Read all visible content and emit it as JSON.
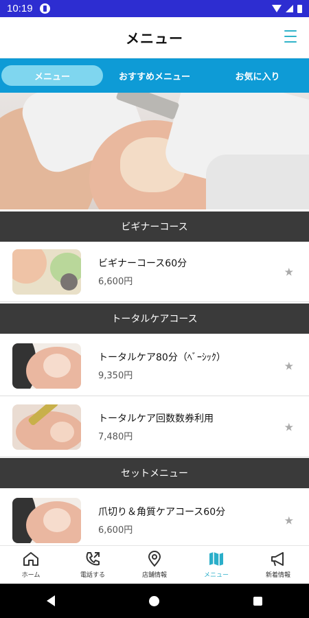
{
  "status_bar": {
    "time": "10:19"
  },
  "header": {
    "title": "メニュー"
  },
  "tabs": [
    {
      "label": "メニュー",
      "active": true
    },
    {
      "label": "おすすめメニュー",
      "active": false
    },
    {
      "label": "お気に入り",
      "active": false
    }
  ],
  "sections": [
    {
      "title": "ビギナーコース"
    },
    {
      "title": "トータルケアコース"
    },
    {
      "title": "セットメニュー"
    }
  ],
  "items": [
    {
      "name": "ビギナーコース60分",
      "price": "6,600円"
    },
    {
      "name": "トータルケア80分（ﾍﾞｰｼｯｸ）",
      "price": "9,350円"
    },
    {
      "name": "トータルケア回数数券利用",
      "price": "7,480円"
    },
    {
      "name": "爪切り＆角質ケアコース60分",
      "price": "6,600円"
    }
  ],
  "bottom_nav": [
    {
      "label": "ホーム",
      "icon": "home-icon"
    },
    {
      "label": "電話する",
      "icon": "phone-icon"
    },
    {
      "label": "店舗情報",
      "icon": "map-pin-icon"
    },
    {
      "label": "メニュー",
      "icon": "book-icon",
      "active": true
    },
    {
      "label": "新着情報",
      "icon": "megaphone-icon"
    }
  ],
  "colors": {
    "status_bar": "#2d2dd1",
    "tabs": "#0e9bd6",
    "active_tab": "#7fd6ef",
    "accent": "#2aaec9",
    "section": "#3a3a3a"
  }
}
